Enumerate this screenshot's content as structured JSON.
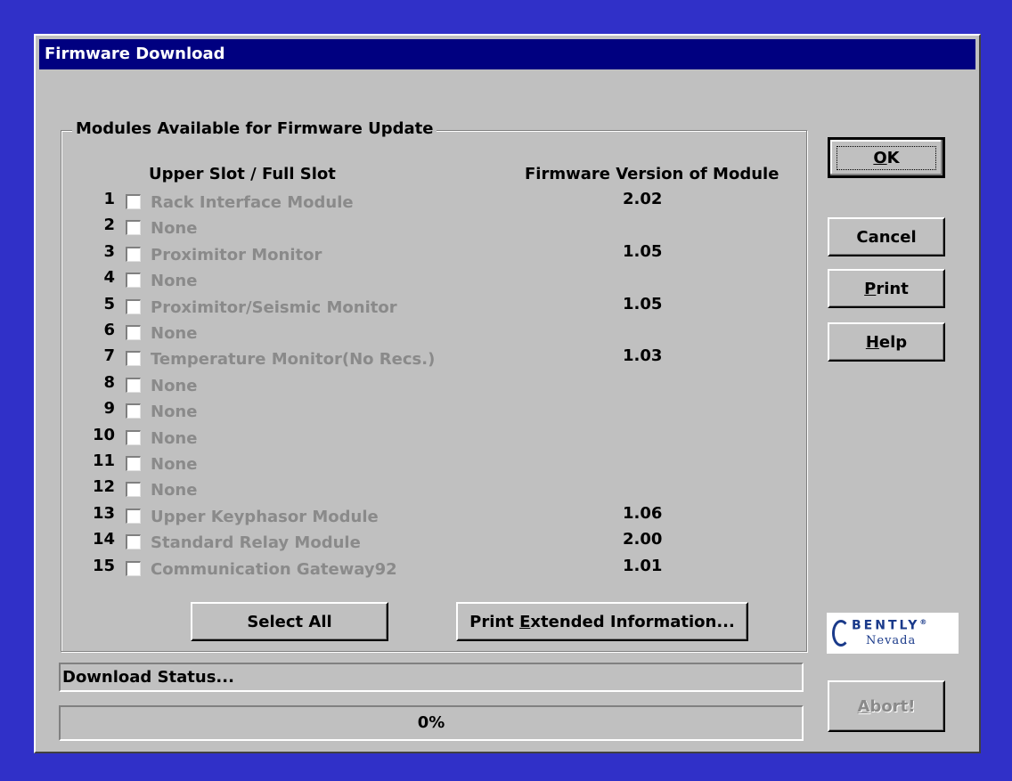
{
  "window": {
    "title": "Firmware Download"
  },
  "group": {
    "legend": "Modules Available for Firmware Update",
    "col_slot": "Upper Slot / Full Slot",
    "col_version": "Firmware Version of Module"
  },
  "modules": [
    {
      "num": "1",
      "name": "Rack Interface Module",
      "version": "2.02",
      "checked": false
    },
    {
      "num": "2",
      "name": "None",
      "version": "",
      "checked": false
    },
    {
      "num": "3",
      "name": "Proximitor Monitor",
      "version": "1.05",
      "checked": false
    },
    {
      "num": "4",
      "name": "None",
      "version": "",
      "checked": false
    },
    {
      "num": "5",
      "name": "Proximitor/Seismic Monitor",
      "version": "1.05",
      "checked": false
    },
    {
      "num": "6",
      "name": "None",
      "version": "",
      "checked": false
    },
    {
      "num": "7",
      "name": "Temperature Monitor(No Recs.)",
      "version": "1.03",
      "checked": false
    },
    {
      "num": "8",
      "name": "None",
      "version": "",
      "checked": false
    },
    {
      "num": "9",
      "name": "None",
      "version": "",
      "checked": false
    },
    {
      "num": "10",
      "name": "None",
      "version": "",
      "checked": false
    },
    {
      "num": "11",
      "name": "None",
      "version": "",
      "checked": false
    },
    {
      "num": "12",
      "name": "None",
      "version": "",
      "checked": false
    },
    {
      "num": "13",
      "name": "Upper Keyphasor Module",
      "version": "1.06",
      "checked": false
    },
    {
      "num": "14",
      "name": "Standard Relay Module",
      "version": "2.00",
      "checked": false
    },
    {
      "num": "15",
      "name": "Communication Gateway92",
      "version": "1.01",
      "checked": false
    }
  ],
  "buttons": {
    "select_all": "Select All",
    "print_ext_pre": "Print ",
    "print_ext_u": "E",
    "print_ext_post": "xtended Information...",
    "ok_u": "O",
    "ok_post": "K",
    "cancel": "Cancel",
    "print_u": "P",
    "print_post": "rint",
    "help_u": "H",
    "help_post": "elp",
    "abort_u": "A",
    "abort_post": "bort!"
  },
  "status": {
    "label": "Download Status...",
    "progress_text": "0%",
    "progress_value": 0
  },
  "logo": {
    "line1": "BENTLY",
    "reg": "®",
    "line2": "Nevada"
  },
  "colors": {
    "desktop": "#3030c8",
    "titlebar": "#000080",
    "face": "#c0c0c0",
    "disabled_text": "#8a8a8a"
  }
}
